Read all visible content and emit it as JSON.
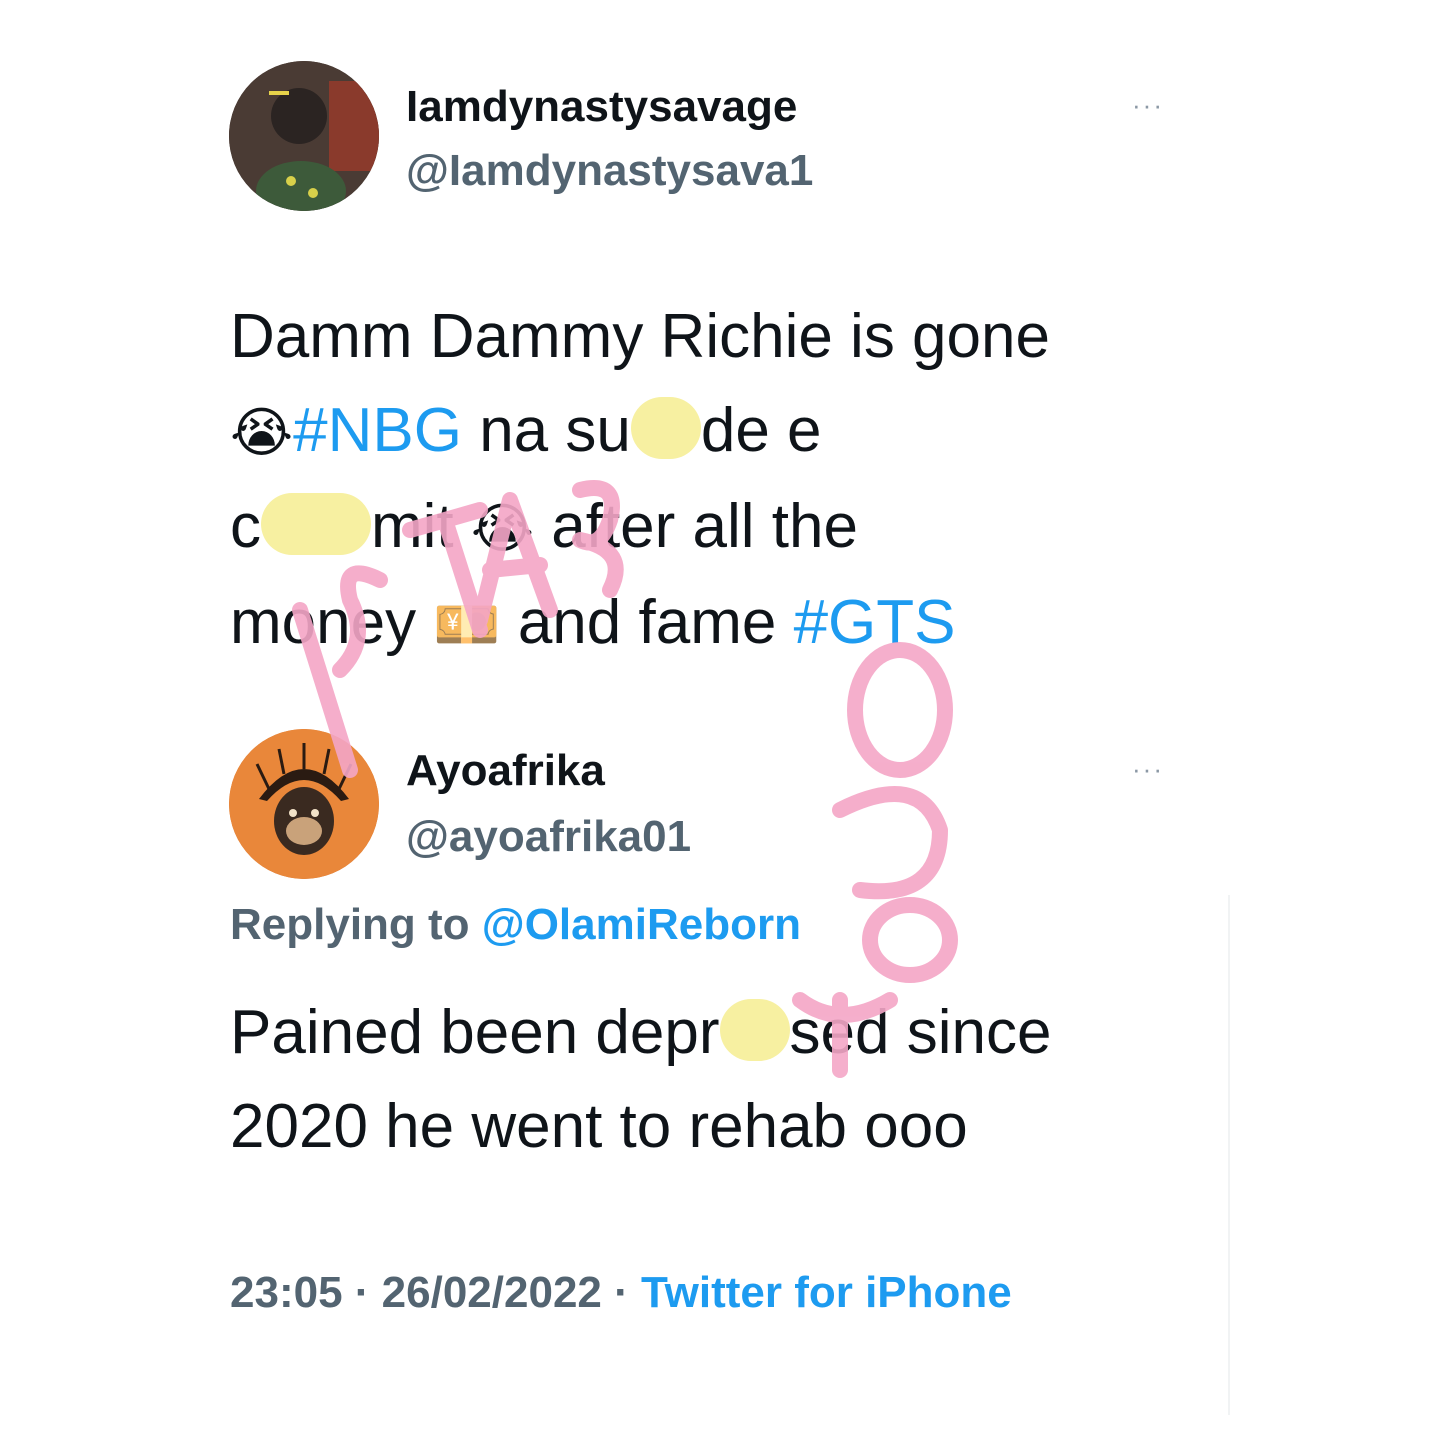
{
  "tweet1": {
    "display_name": "Iamdynastysavage",
    "handle": "@Iamdynastysava1",
    "more": "···",
    "line1": "Damm Dammy Richie is gone",
    "emoji_sob": "😭",
    "hashtag1": "#NBG",
    "text_a": "na su",
    "text_b": "de e",
    "text_c": "c",
    "text_d": "mit",
    "text_e": "after all the",
    "text_f": "money",
    "emoji_money": "💴",
    "text_g": "and fame",
    "hashtag2": "#GTS"
  },
  "tweet2": {
    "display_name": "Ayoafrika",
    "handle": "@ayoafrika01",
    "more": "···",
    "replying_prefix": "Replying to",
    "replying_to": "@OlamiReborn",
    "text_a": "Pained been depr",
    "text_b": "sed since",
    "line2": "2020 he went to rehab ooo",
    "time": "23:05",
    "date": "26/02/2022",
    "separator": "·",
    "source": "Twitter for iPhone"
  },
  "colors": {
    "link": "#1d9bf0",
    "secondary": "#536471",
    "watermark": "#f4a6c6",
    "blur": "#f7f0a1"
  }
}
